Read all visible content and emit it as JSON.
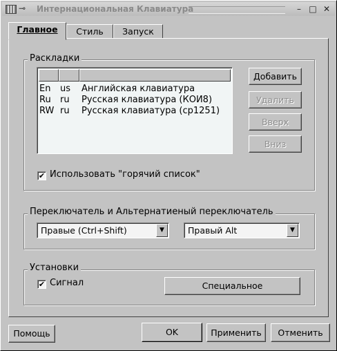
{
  "window": {
    "title": "Интернациональная Клавиатура",
    "minimize_glyph": "–",
    "maximize_glyph": "□",
    "close_glyph": "✕",
    "pin_glyph": "⊸"
  },
  "tabs": [
    {
      "label": "Главное",
      "active": true
    },
    {
      "label": "Стиль",
      "active": false
    },
    {
      "label": "Запуск",
      "active": false
    }
  ],
  "layouts": {
    "title": "Раскладки",
    "rows": [
      {
        "code": "En",
        "lang": "us",
        "name": "Английская клавиатура"
      },
      {
        "code": "Ru",
        "lang": "ru",
        "name": "Русская клавиатура (КОИ8)"
      },
      {
        "code": "RW",
        "lang": "ru",
        "name": "Русская клавиатура (cp1251)"
      }
    ],
    "buttons": {
      "add": "Добавить",
      "delete": "Удалить",
      "up": "Вверх",
      "down": "Вниз"
    },
    "hotlist_label": "Использовать \"горячий список\"",
    "hotlist_checked": true
  },
  "switcher": {
    "title": "Переключатель и Альтернатиеный переключатель",
    "primary": "Правые (Ctrl+Shift)",
    "alternate": "Правый Alt"
  },
  "settings": {
    "title": "Установки",
    "beep_label": "Сигнал",
    "beep_checked": true,
    "special_button": "Специальное"
  },
  "footer": {
    "help": "Помощь",
    "ok": "OK",
    "apply": "Применить",
    "cancel": "Отменить"
  },
  "glyphs": {
    "check": "✔",
    "combo_arrow": "▼"
  }
}
